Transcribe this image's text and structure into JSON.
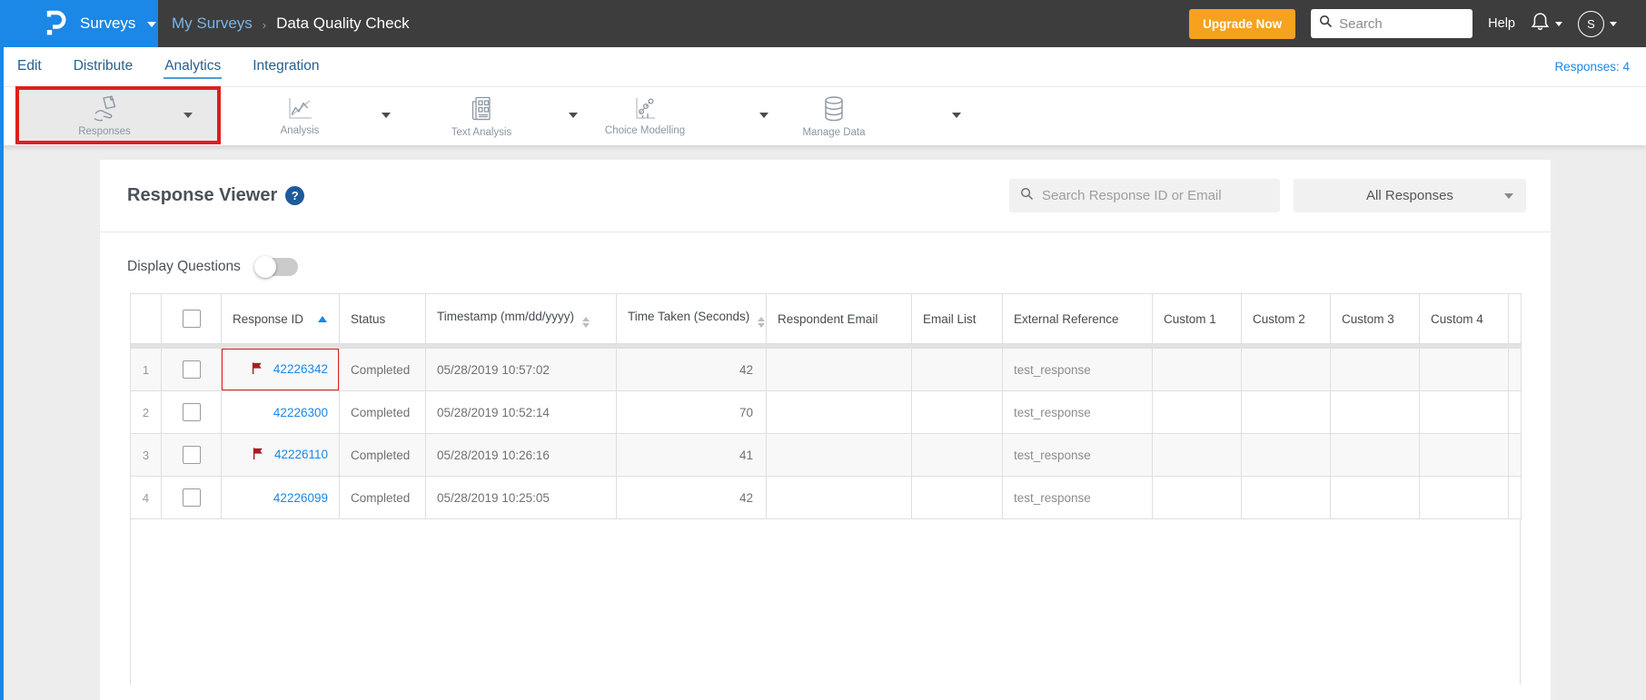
{
  "colors": {
    "brand_blue": "#1b87e6",
    "topbar_dark": "#3d3d3d",
    "upgrade_orange": "#f6a21e",
    "annotation_red": "#de1f1a",
    "flag_red": "#a81e22",
    "link_blue": "#1b87e6"
  },
  "topbar": {
    "product_menu_label": "Surveys",
    "breadcrumb_parent": "My Surveys",
    "breadcrumb_separator": "›",
    "breadcrumb_current": "Data Quality Check",
    "upgrade_label": "Upgrade Now",
    "search_placeholder": "Search",
    "help_label": "Help",
    "avatar_initial": "S"
  },
  "nav": {
    "tabs": [
      {
        "label": "Edit",
        "active": false
      },
      {
        "label": "Distribute",
        "active": false
      },
      {
        "label": "Analytics",
        "active": true
      },
      {
        "label": "Integration",
        "active": false
      }
    ],
    "responses_count_label": "Responses: 4"
  },
  "toolbar": {
    "items": [
      {
        "label": "Responses",
        "icon": "responses-icon",
        "active": true,
        "annotated": true
      },
      {
        "label": "Analysis",
        "icon": "analysis-icon",
        "active": false,
        "annotated": false
      },
      {
        "label": "Text Analysis",
        "icon": "text-analysis-icon",
        "active": false,
        "annotated": false
      },
      {
        "label": "Choice Modelling",
        "icon": "choice-modelling-icon",
        "active": false,
        "annotated": false
      },
      {
        "label": "Manage Data",
        "icon": "manage-data-icon",
        "active": false,
        "annotated": false
      }
    ]
  },
  "panel": {
    "title": "Response Viewer",
    "help_icon": "?",
    "search_placeholder": "Search Response ID or Email",
    "filter_selected": "All Responses",
    "display_questions_label": "Display Questions",
    "display_questions_state": "off"
  },
  "table": {
    "columns": [
      "",
      "",
      "Response ID",
      "Status",
      "Timestamp (mm/dd/yyyy)",
      "Time Taken (Seconds)",
      "Respondent Email",
      "Email List",
      "External Reference",
      "Custom 1",
      "Custom 2",
      "Custom 3",
      "Custom 4",
      ""
    ],
    "sorted_column": "Response ID",
    "sort_direction": "asc",
    "rows": [
      {
        "num": "1",
        "flagged": true,
        "annotated": true,
        "response_id": "42226342",
        "status": "Completed",
        "timestamp": "05/28/2019 10:57:02",
        "time_taken": "42",
        "respondent_email": "",
        "email_list": "",
        "external_reference": "test_response",
        "custom1": "",
        "custom2": "",
        "custom3": "",
        "custom4": ""
      },
      {
        "num": "2",
        "flagged": false,
        "annotated": false,
        "response_id": "42226300",
        "status": "Completed",
        "timestamp": "05/28/2019 10:52:14",
        "time_taken": "70",
        "respondent_email": "",
        "email_list": "",
        "external_reference": "test_response",
        "custom1": "",
        "custom2": "",
        "custom3": "",
        "custom4": ""
      },
      {
        "num": "3",
        "flagged": true,
        "annotated": false,
        "response_id": "42226110",
        "status": "Completed",
        "timestamp": "05/28/2019 10:26:16",
        "time_taken": "41",
        "respondent_email": "",
        "email_list": "",
        "external_reference": "test_response",
        "custom1": "",
        "custom2": "",
        "custom3": "",
        "custom4": ""
      },
      {
        "num": "4",
        "flagged": false,
        "annotated": false,
        "response_id": "42226099",
        "status": "Completed",
        "timestamp": "05/28/2019 10:25:05",
        "time_taken": "42",
        "respondent_email": "",
        "email_list": "",
        "external_reference": "test_response",
        "custom1": "",
        "custom2": "",
        "custom3": "",
        "custom4": ""
      }
    ]
  }
}
